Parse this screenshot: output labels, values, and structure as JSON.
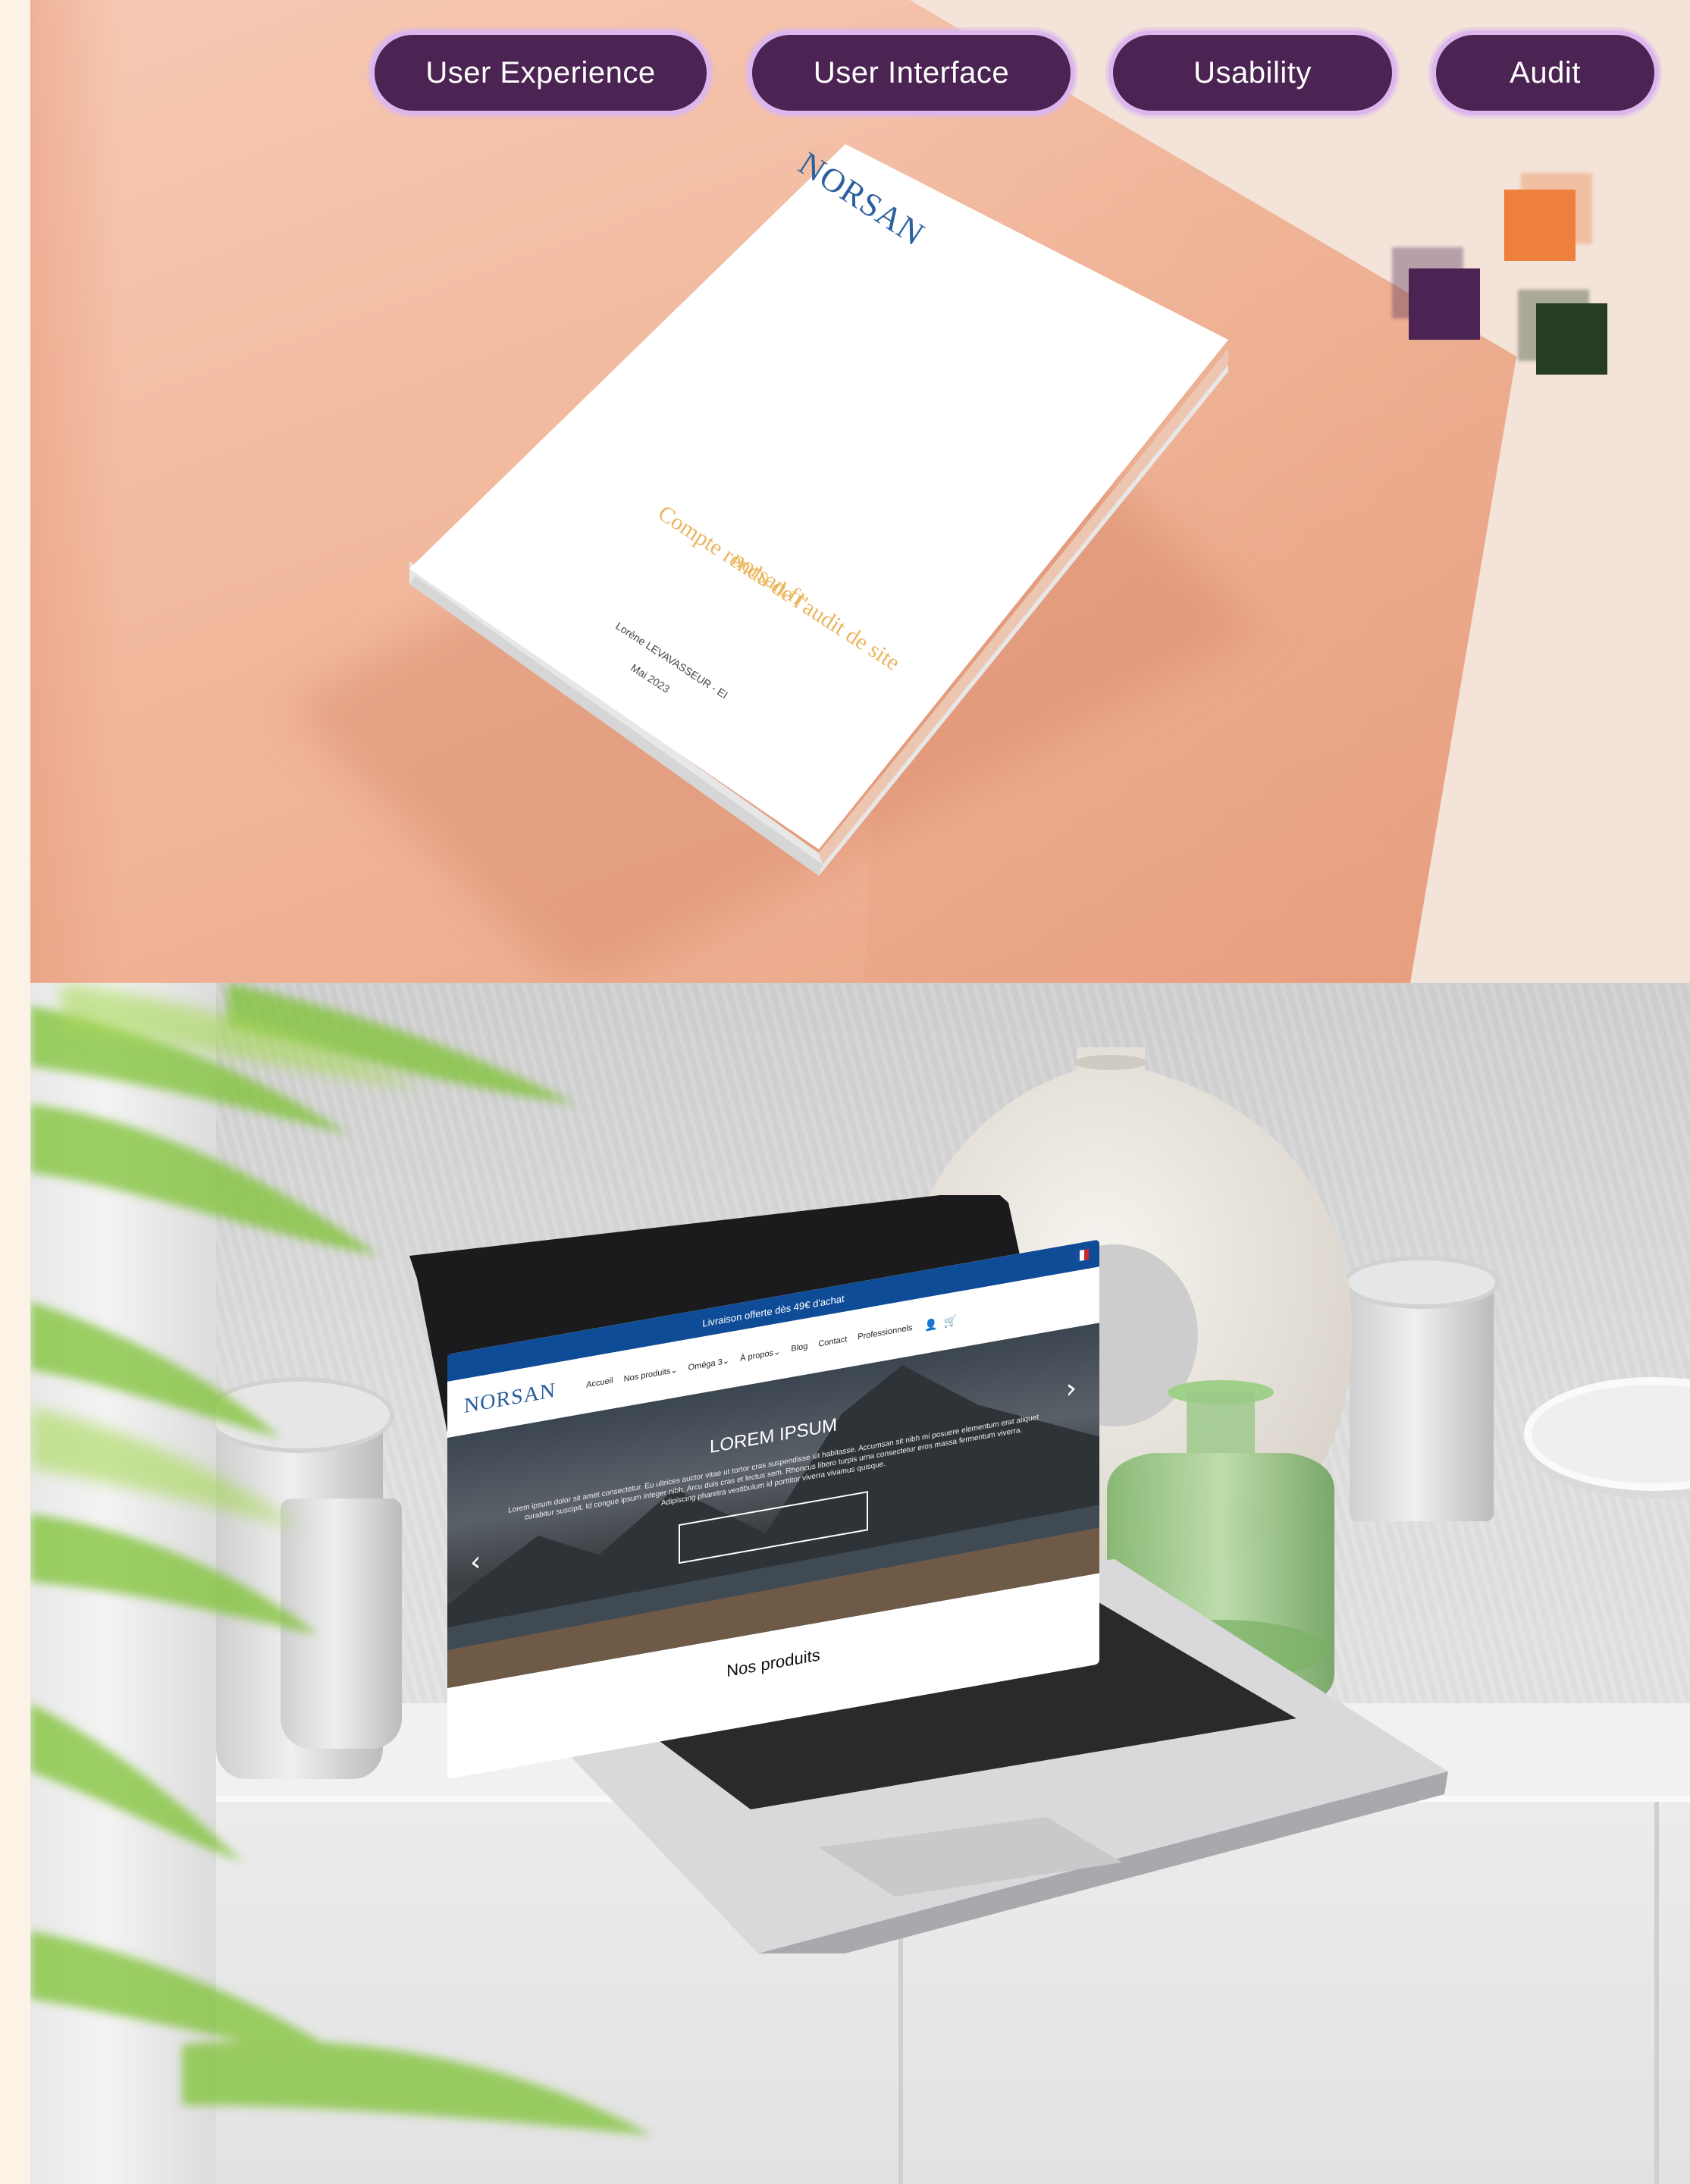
{
  "tags": [
    "User Experience",
    "User Interface",
    "Usability",
    "Audit"
  ],
  "colors": {
    "pill_bg": "#4b2453",
    "pill_border": "#dcb7ee",
    "square_orange": "#ef7f3c",
    "square_purple": "#4b2453",
    "square_green": "#263d21",
    "site_blue": "#0f4c97",
    "cover_gold": "#eab65e"
  },
  "book": {
    "logo": "NORSAN",
    "title": "Compte rendu de l'audit de site",
    "site": "norsan.fr",
    "author": "Lorène LEVAVASSEUR - EI",
    "date": "Mai 2023"
  },
  "website": {
    "promo_banner": "Livraison offerte dès 49€ d'achat",
    "logo": "NORSAN",
    "nav": [
      "Accueil",
      "Nos produits",
      "Oméga 3",
      "À propos",
      "Blog",
      "Contact",
      "Professionnels"
    ],
    "hero_title": "LOREM IPSUM",
    "hero_text": "Lorem ipsum dolor sit amet consectetur. Eu ultrices auctor vitae ut tortor cras suspendisse sit habitasse. Accumsan sit nibh mi posuere elementum erat aliquet curabitur suscipit. Id congue ipsum integer nibh. Arcu duis cras et lectus sem. Rhoncus libero turpis urna consectetur eros massa fermentum viverra. Adipiscing pharetra vestibulum id porttitor viverra vivamus quisque.",
    "section_title": "Nos produits"
  }
}
